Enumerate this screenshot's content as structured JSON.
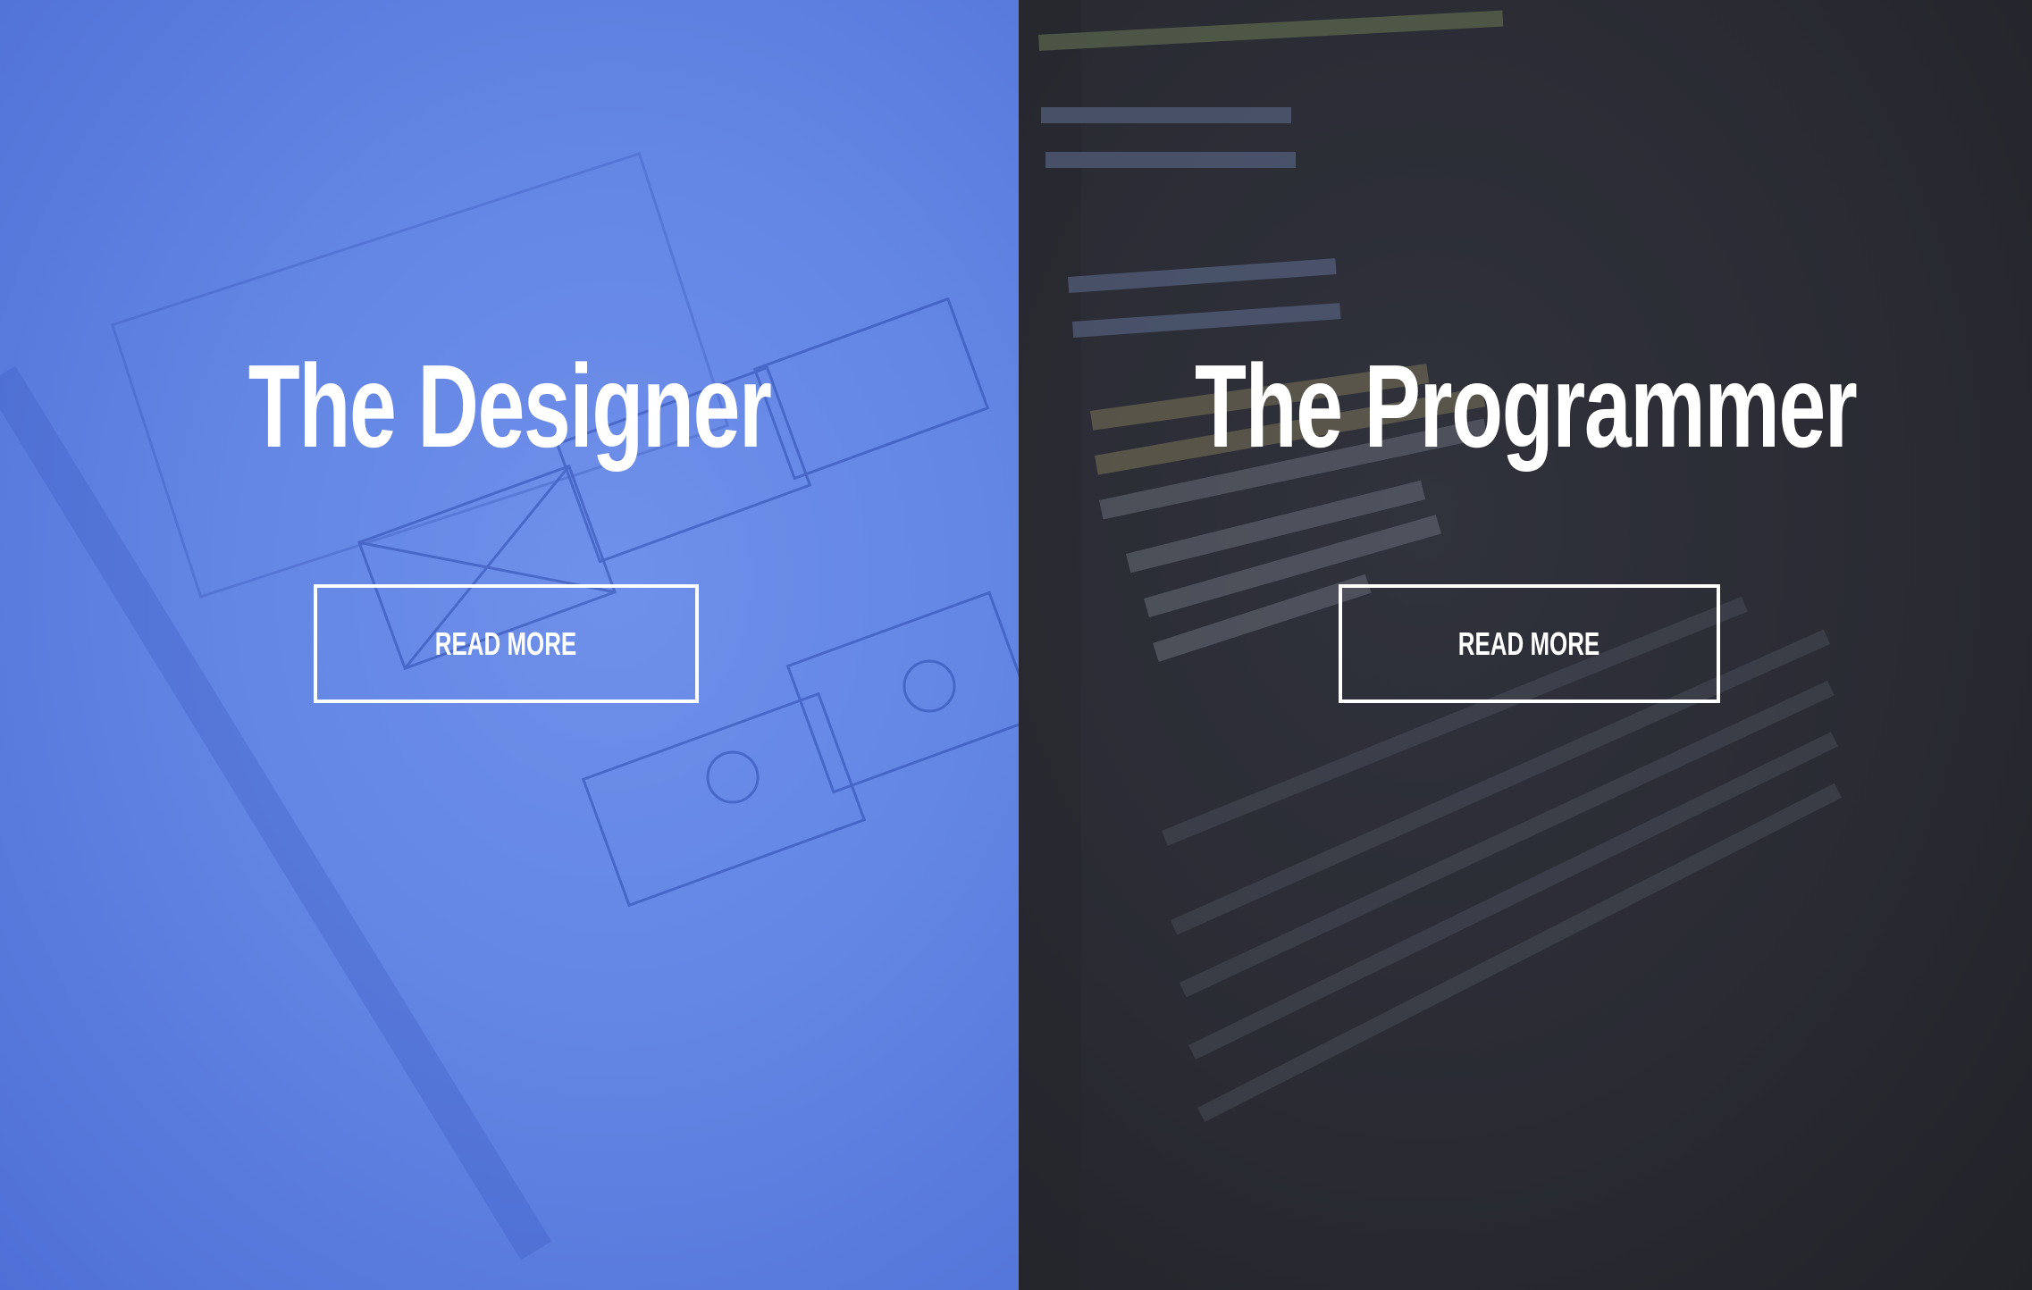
{
  "panels": [
    {
      "title": "The Designer",
      "button_label": "READ MORE",
      "overlay_color": "#6386e4"
    },
    {
      "title": "The Programmer",
      "button_label": "READ MORE",
      "overlay_color": "#2a2b33"
    }
  ]
}
